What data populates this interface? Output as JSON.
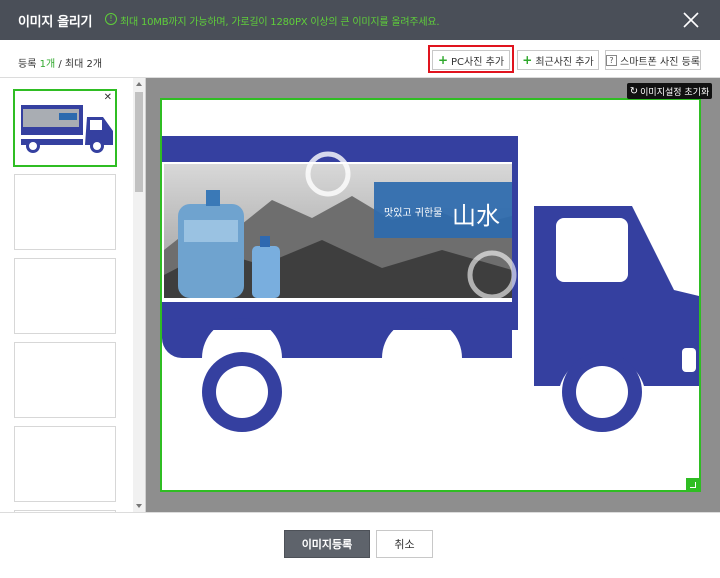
{
  "header": {
    "title": "이미지 올리기",
    "info_icon": "info-icon",
    "notice": "최대 10MB까지 가능하며, 가로길이 1280PX 이상의 큰 이미지를 올려주세요.",
    "close_icon": "close-icon"
  },
  "count": {
    "label_prefix": "등록 ",
    "current": "1개",
    "separator": " / 최대 2개"
  },
  "toolbar": {
    "pc_add_label": "PC사진 추가",
    "recent_add_label": "최근사진 추가",
    "phone_add_label": "스마트폰 사진 등록",
    "phone_icon_glyph": "?"
  },
  "reset_label": "이미지설정 초기화",
  "image": {
    "caption_small": "맛있고 귀한물",
    "caption_big": "山水",
    "truck_color": "#3540a0",
    "banner_color": "#2c6aae"
  },
  "footer": {
    "register_label": "이미지등록",
    "cancel_label": "취소"
  },
  "colors": {
    "accent_green": "#2fbd23",
    "header_bg": "#4a4f58",
    "highlight_red": "#e0141e"
  }
}
